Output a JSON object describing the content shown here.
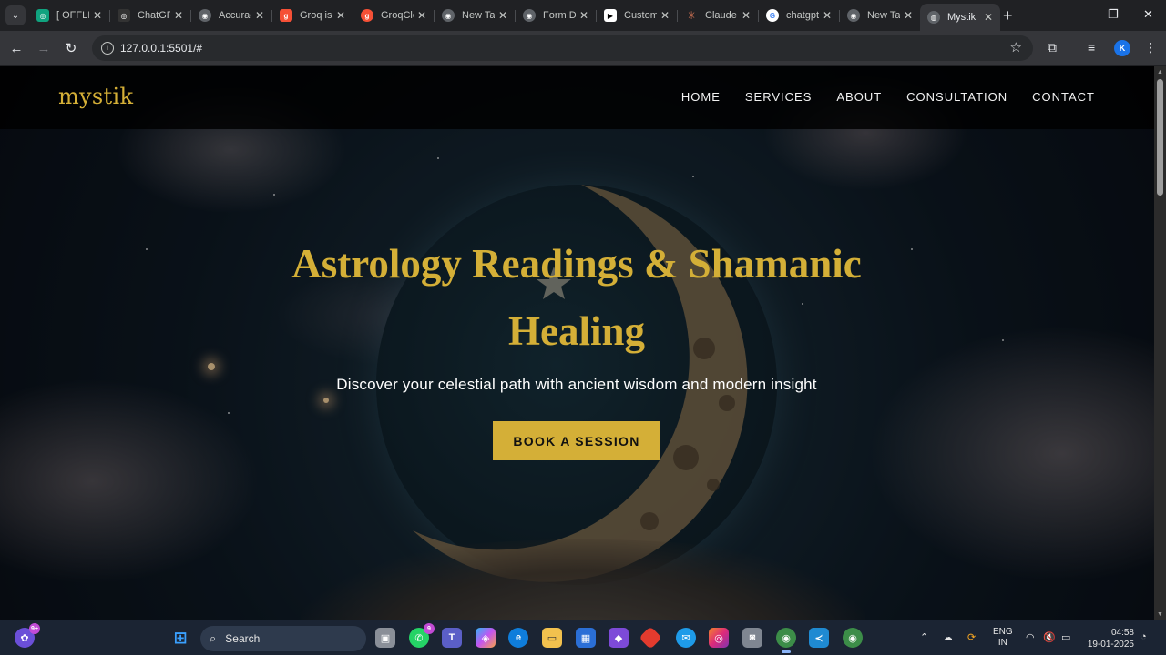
{
  "browser": {
    "tabs": [
      {
        "title": "[ OFFLINE",
        "favicon": "chatgpt-icon",
        "color": "#10a37f"
      },
      {
        "title": "ChatGPT",
        "favicon": "chatgpt-icon",
        "color": "#444"
      },
      {
        "title": "Accuracy",
        "favicon": "chrome-icon",
        "color": "#666"
      },
      {
        "title": "Groq is",
        "favicon": "groq-icon",
        "color": "#f55036"
      },
      {
        "title": "GroqCloud",
        "favicon": "groq-icon",
        "color": "#f55036"
      },
      {
        "title": "New Tab",
        "favicon": "chrome-icon",
        "color": "#666"
      },
      {
        "title": "Form Data",
        "favicon": "chrome-icon",
        "color": "#666"
      },
      {
        "title": "Custom",
        "favicon": "custom-icon",
        "color": "#fff"
      },
      {
        "title": "Claude",
        "favicon": "claude-icon",
        "color": "#d97757"
      },
      {
        "title": "chatgpt",
        "favicon": "google-icon",
        "color": "#fff"
      },
      {
        "title": "New Tab",
        "favicon": "chrome-icon",
        "color": "#666"
      },
      {
        "title": "Mystik",
        "favicon": "globe-icon",
        "color": "#888",
        "active": true
      }
    ],
    "url": "127.0.0.1:5501/#",
    "profile_initial": "K"
  },
  "site": {
    "logo": "mystik",
    "nav": [
      "HOME",
      "SERVICES",
      "ABOUT",
      "CONSULTATION",
      "CONTACT"
    ],
    "hero": {
      "title": "Astrology Readings & Shamanic Healing",
      "subtitle": "Discover your celestial path with ancient wisdom and modern insight",
      "cta": "BOOK A SESSION"
    },
    "colors": {
      "gold": "#d4af37",
      "header_bg": "#000000"
    }
  },
  "taskbar": {
    "search_label": "Search",
    "notification_badge": "9+",
    "whatsapp_badge": "9",
    "language": {
      "line1": "ENG",
      "line2": "IN"
    },
    "time": "04:58",
    "date": "19-01-2025"
  }
}
